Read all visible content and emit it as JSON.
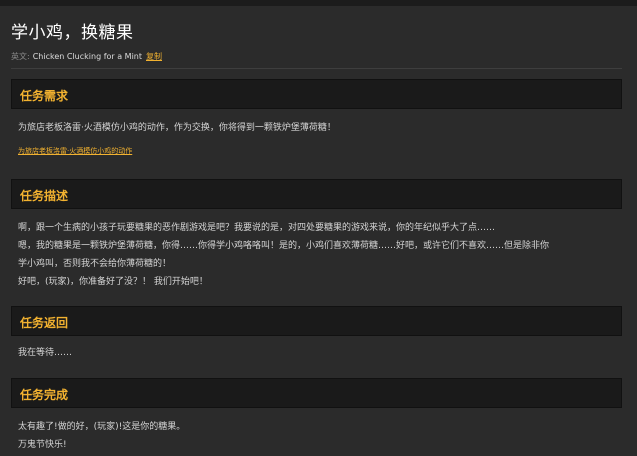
{
  "page": {
    "title": "学小鸡，换糖果",
    "english_label": "英文:",
    "english_title": "Chicken Clucking for a Mint",
    "copy_label": "复制"
  },
  "sections": {
    "requirement": {
      "header": "任务需求",
      "text": "为旅店老板洛雷·火酒模仿小鸡的动作，作为交换，你将得到一颗铁炉堡薄荷糖！",
      "link": "为旅店老板洛雷·火酒模仿小鸡的动作"
    },
    "description": {
      "header": "任务描述",
      "line1": "啊，跟一个生病的小孩子玩要糖果的恶作剧游戏是吧？我要说的是，对四处要糖果的游戏来说，你的年纪似乎大了点……",
      "line2": "嗯，我的糖果是一颗铁炉堡薄荷糖，你得……你得学小鸡咯咯叫！是的，小鸡们喜欢薄荷糖……好吧，或许它们不喜欢……但是除非你",
      "line3": "学小鸡叫，否则我不会给你薄荷糖的！",
      "line4": "好吧，(玩家)，你准备好了没？！ 我们开始吧！"
    },
    "return": {
      "header": "任务返回",
      "text": "我在等待……"
    },
    "complete": {
      "header": "任务完成",
      "line1": "太有趣了!做的好，(玩家)!这是你的糖果。",
      "line2": "万鬼节快乐!"
    }
  },
  "colors": {
    "background": "#2b2b2b",
    "header_bg": "#1a1a1a",
    "accent": "#f2b230",
    "text": "#d4d4d4"
  }
}
